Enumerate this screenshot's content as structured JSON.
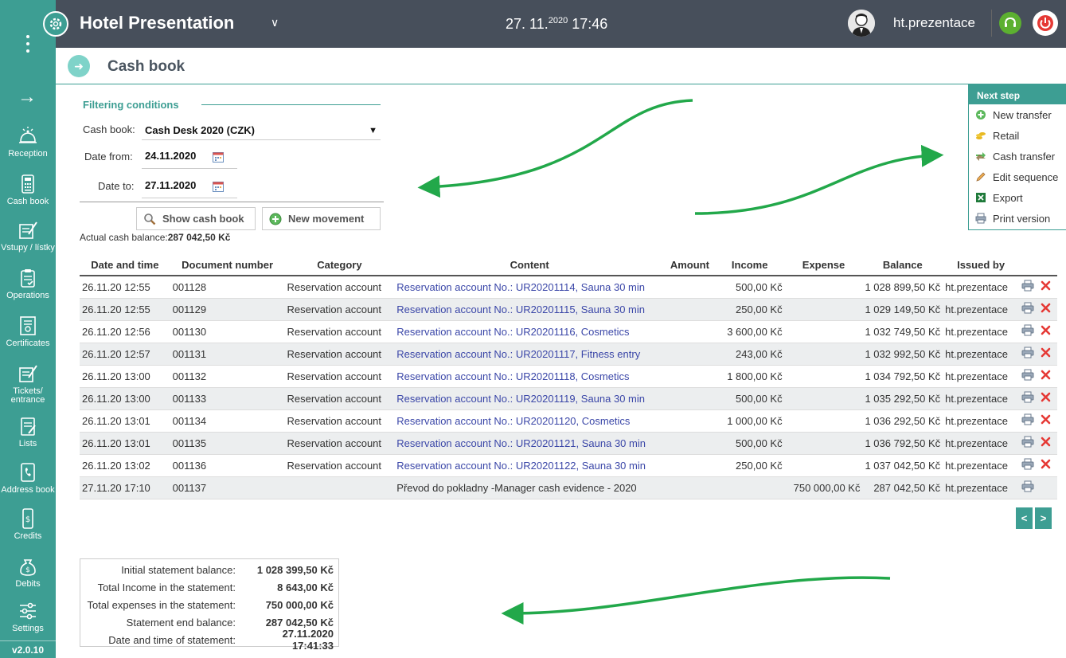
{
  "sidebar": {
    "items": [
      {
        "label": "Reception",
        "icon": "bell-icon"
      },
      {
        "label": "Cash book",
        "icon": "calculator-icon"
      },
      {
        "label": "Vstupy / lístky",
        "icon": "ticket-icon"
      },
      {
        "label": "Operations",
        "icon": "clipboard-icon"
      },
      {
        "label": "Certificates",
        "icon": "certificate-icon"
      },
      {
        "label": "Tickets/ entrance",
        "icon": "ticket-icon"
      },
      {
        "label": "Lists",
        "icon": "list-icon"
      },
      {
        "label": "Address book",
        "icon": "address-book-icon"
      },
      {
        "label": "Credits",
        "icon": "phone-money-icon"
      },
      {
        "label": "Debits",
        "icon": "money-bag-icon"
      },
      {
        "label": "Settings",
        "icon": "sliders-icon"
      }
    ],
    "version": "v2.0.10"
  },
  "topbar": {
    "title": "Hotel Presentation",
    "date": "27. 11.",
    "year": "2020",
    "time": "17:46",
    "username": "ht.prezentace"
  },
  "page": {
    "title": "Cash book"
  },
  "filter": {
    "title": "Filtering conditions",
    "cashbook_label": "Cash book:",
    "cashbook_value": "Cash Desk 2020 (CZK)",
    "date_from_label": "Date from:",
    "date_from_value": "24.11.2020",
    "date_to_label": "Date to:",
    "date_to_value": "27.11.2020",
    "show_button": "Show cash book",
    "new_button": "New movement",
    "balance_label": "Actual cash balance:",
    "balance_value": "287 042,50 Kč"
  },
  "next_step": {
    "title": "Next step",
    "items": [
      {
        "label": "New transfer",
        "icon": "plus-circle-icon"
      },
      {
        "label": "Retail",
        "icon": "coins-icon"
      },
      {
        "label": "Cash transfer",
        "icon": "transfer-arrows-icon"
      },
      {
        "label": "Edit sequence",
        "icon": "pencil-icon"
      },
      {
        "label": "Export",
        "icon": "excel-icon"
      },
      {
        "label": "Print version",
        "icon": "printer-icon"
      }
    ]
  },
  "table": {
    "headers": [
      "Date and time",
      "Document number",
      "Category",
      "Content",
      "Amount",
      "Income",
      "Expense",
      "Balance",
      "Issued by"
    ],
    "rows": [
      {
        "date": "26.11.20 12:55",
        "doc": "001128",
        "category": "Reservation account",
        "content": "Reservation account No.: UR20201114, Sauna 30 min",
        "link": true,
        "amount": "",
        "income": "500,00 Kč",
        "expense": "",
        "balance": "1 028 899,50 Kč",
        "issued": "ht.prezentace",
        "deletable": true
      },
      {
        "date": "26.11.20 12:55",
        "doc": "001129",
        "category": "Reservation account",
        "content": "Reservation account No.: UR20201115, Sauna 30 min",
        "link": true,
        "amount": "",
        "income": "250,00 Kč",
        "expense": "",
        "balance": "1 029 149,50 Kč",
        "issued": "ht.prezentace",
        "deletable": true
      },
      {
        "date": "26.11.20 12:56",
        "doc": "001130",
        "category": "Reservation account",
        "content": "Reservation account No.: UR20201116, Cosmetics",
        "link": true,
        "amount": "",
        "income": "3 600,00 Kč",
        "expense": "",
        "balance": "1 032 749,50 Kč",
        "issued": "ht.prezentace",
        "deletable": true
      },
      {
        "date": "26.11.20 12:57",
        "doc": "001131",
        "category": "Reservation account",
        "content": "Reservation account No.: UR20201117, Fitness entry",
        "link": true,
        "amount": "",
        "income": "243,00 Kč",
        "expense": "",
        "balance": "1 032 992,50 Kč",
        "issued": "ht.prezentace",
        "deletable": true
      },
      {
        "date": "26.11.20 13:00",
        "doc": "001132",
        "category": "Reservation account",
        "content": "Reservation account No.: UR20201118, Cosmetics",
        "link": true,
        "amount": "",
        "income": "1 800,00 Kč",
        "expense": "",
        "balance": "1 034 792,50 Kč",
        "issued": "ht.prezentace",
        "deletable": true
      },
      {
        "date": "26.11.20 13:00",
        "doc": "001133",
        "category": "Reservation account",
        "content": "Reservation account No.: UR20201119, Sauna 30 min",
        "link": true,
        "amount": "",
        "income": "500,00 Kč",
        "expense": "",
        "balance": "1 035 292,50 Kč",
        "issued": "ht.prezentace",
        "deletable": true
      },
      {
        "date": "26.11.20 13:01",
        "doc": "001134",
        "category": "Reservation account",
        "content": "Reservation account No.: UR20201120, Cosmetics",
        "link": true,
        "amount": "",
        "income": "1 000,00 Kč",
        "expense": "",
        "balance": "1 036 292,50 Kč",
        "issued": "ht.prezentace",
        "deletable": true
      },
      {
        "date": "26.11.20 13:01",
        "doc": "001135",
        "category": "Reservation account",
        "content": "Reservation account No.: UR20201121, Sauna 30 min",
        "link": true,
        "amount": "",
        "income": "500,00 Kč",
        "expense": "",
        "balance": "1 036 792,50 Kč",
        "issued": "ht.prezentace",
        "deletable": true
      },
      {
        "date": "26.11.20 13:02",
        "doc": "001136",
        "category": "Reservation account",
        "content": "Reservation account No.: UR20201122, Sauna 30 min",
        "link": true,
        "amount": "",
        "income": "250,00 Kč",
        "expense": "",
        "balance": "1 037 042,50 Kč",
        "issued": "ht.prezentace",
        "deletable": true
      },
      {
        "date": "27.11.20 17:10",
        "doc": "001137",
        "category": "",
        "content": "Převod do pokladny -Manager cash evidence - 2020",
        "link": false,
        "amount": "",
        "income": "",
        "expense": "750 000,00 Kč",
        "balance": "287 042,50 Kč",
        "issued": "ht.prezentace",
        "deletable": false
      }
    ]
  },
  "pager": {
    "prev": "<",
    "next": ">"
  },
  "summary": [
    {
      "label": "Initial statement balance:",
      "value": "1 028 399,50 Kč"
    },
    {
      "label": "Total Income in the statement:",
      "value": "8 643,00 Kč"
    },
    {
      "label": "Total expenses in the statement:",
      "value": "750 000,00 Kč"
    },
    {
      "label": "Statement end balance:",
      "value": "287 042,50 Kč"
    },
    {
      "label": "Date and time of statement:",
      "value": "27.11.2020 17:41:33"
    }
  ],
  "colors": {
    "accent": "#3d9e93",
    "topbar": "#474f5b",
    "link": "#3b47a8",
    "delete": "#e53935",
    "arrow": "#22a84a"
  }
}
